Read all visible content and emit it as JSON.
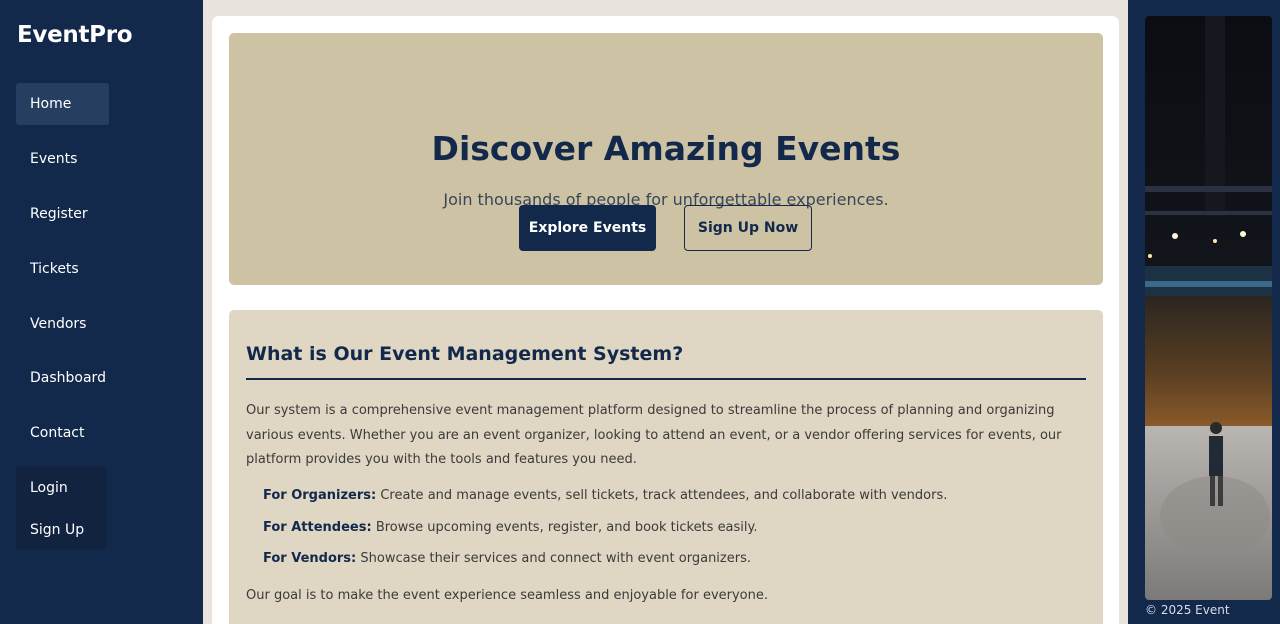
{
  "brand": "EventPro",
  "nav": {
    "items": [
      {
        "label": "Home",
        "active": true
      },
      {
        "label": "Events"
      },
      {
        "label": "Register"
      },
      {
        "label": "Tickets"
      },
      {
        "label": "Vendors"
      },
      {
        "label": "Dashboard"
      },
      {
        "label": "Contact"
      }
    ],
    "auth": [
      "Login",
      "Sign Up"
    ]
  },
  "hero": {
    "title": "Discover Amazing Events",
    "subtitle": "Join thousands of people for unforgettable experiences.",
    "primary_button": "Explore Events",
    "secondary_button": "Sign Up Now"
  },
  "info": {
    "title": "What is Our Event Management System?",
    "intro": "Our system is a comprehensive event management platform designed to streamline the process of planning and organizing various events. Whether you are an event organizer, looking to attend an event, or a vendor offering services for events, our platform provides you with the tools and features you need.",
    "features": [
      {
        "label": "For Organizers:",
        "text": "Create and manage events, sell tickets, track attendees, and collaborate with vendors."
      },
      {
        "label": "For Attendees:",
        "text": "Browse upcoming events, register, and book tickets easily."
      },
      {
        "label": "For Vendors:",
        "text": "Showcase their services and connect with event organizers."
      }
    ],
    "goal": "Our goal is to make the event experience seamless and enjoyable for everyone."
  },
  "footer": {
    "text": "© 2025 Event"
  },
  "colors": {
    "navy": "#13294b",
    "hero_bg": "#cdc2a3",
    "info_bg": "#dfd6c3",
    "page_bg": "#e9e3dd"
  },
  "image": {
    "icon": "event-photo-icon"
  }
}
